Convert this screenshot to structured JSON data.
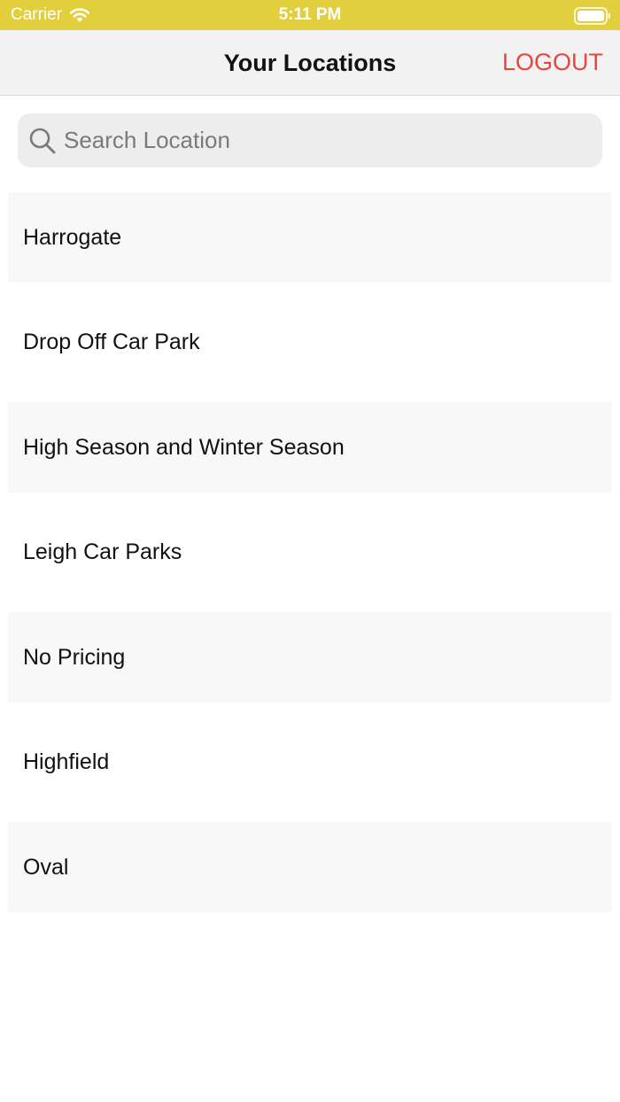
{
  "status_bar": {
    "carrier": "Carrier",
    "time": "5:11 PM",
    "wifi_icon": "wifi-icon",
    "battery_icon": "battery-icon",
    "background_color": "#E2CF3E"
  },
  "nav": {
    "title": "Your Locations",
    "logout_label": "LOGOUT",
    "logout_color": "#E8453C"
  },
  "search": {
    "placeholder": "Search Location",
    "value": "",
    "icon": "search-icon"
  },
  "locations": [
    {
      "label": "Harrogate"
    },
    {
      "label": "Drop Off Car Park"
    },
    {
      "label": "High Season and Winter Season"
    },
    {
      "label": "Leigh Car Parks"
    },
    {
      "label": "No Pricing"
    },
    {
      "label": "Highfield"
    },
    {
      "label": "Oval"
    }
  ]
}
